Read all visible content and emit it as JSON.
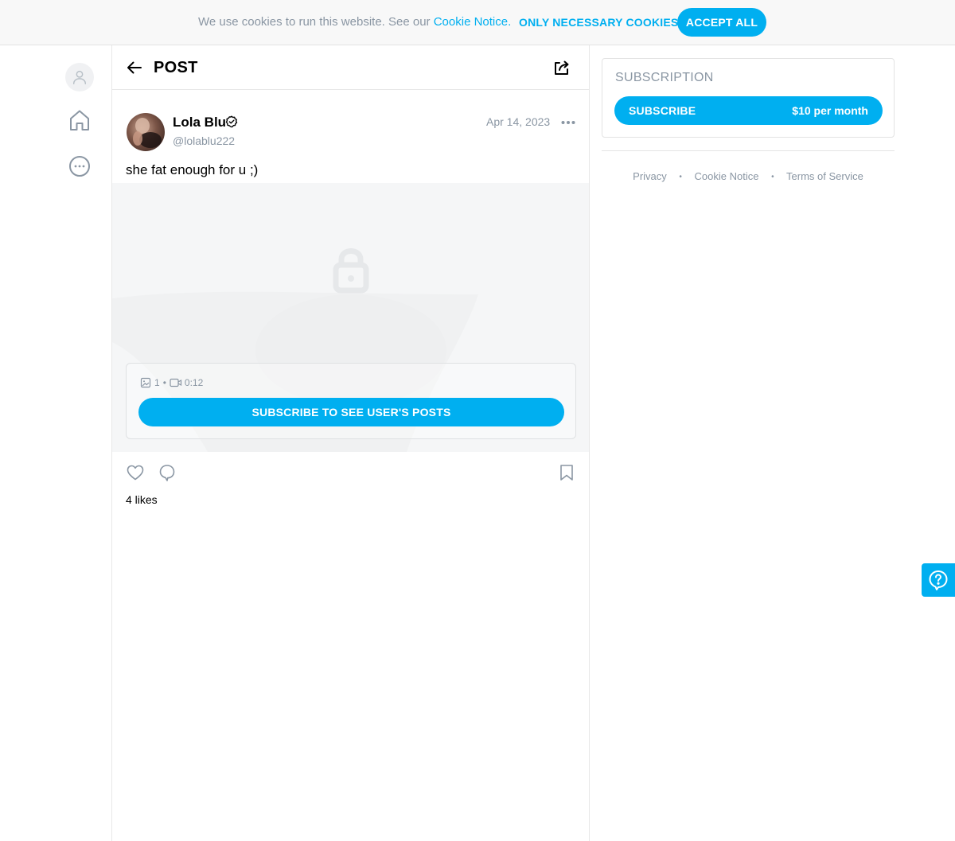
{
  "cookie_bar": {
    "text": "We use cookies to run this website. See our ",
    "link": "Cookie Notice.",
    "necessary_label": "ONLY NECESSARY COOKIES",
    "accept_label": "ACCEPT ALL"
  },
  "header": {
    "title": "POST"
  },
  "post": {
    "author_name": "Lola Blu",
    "author_handle": "@lolablu222",
    "date": "Apr 14, 2023",
    "text": "she fat enough for u ;)",
    "media": {
      "photo_count": "1",
      "separator": "•",
      "video_duration": "0:12",
      "subscribe_label": "SUBSCRIBE TO SEE USER'S POSTS"
    },
    "likes": "4 likes"
  },
  "subscription": {
    "title": "SUBSCRIPTION",
    "button_label": "SUBSCRIBE",
    "price": "$10 per month"
  },
  "footer": {
    "privacy": "Privacy",
    "cookie_notice": "Cookie Notice",
    "terms": "Terms of Service",
    "separator": "•"
  },
  "colors": {
    "accent": "#00aff0",
    "muted_text": "#8a96a3",
    "border": "#e8e8e8"
  },
  "icons": [
    "user-icon",
    "home-icon",
    "more-circle-icon",
    "back-arrow-icon",
    "share-icon",
    "verified-icon",
    "more-dots-icon",
    "lock-icon",
    "photo-icon",
    "video-icon",
    "heart-icon",
    "comment-icon",
    "bookmark-icon",
    "help-icon"
  ]
}
